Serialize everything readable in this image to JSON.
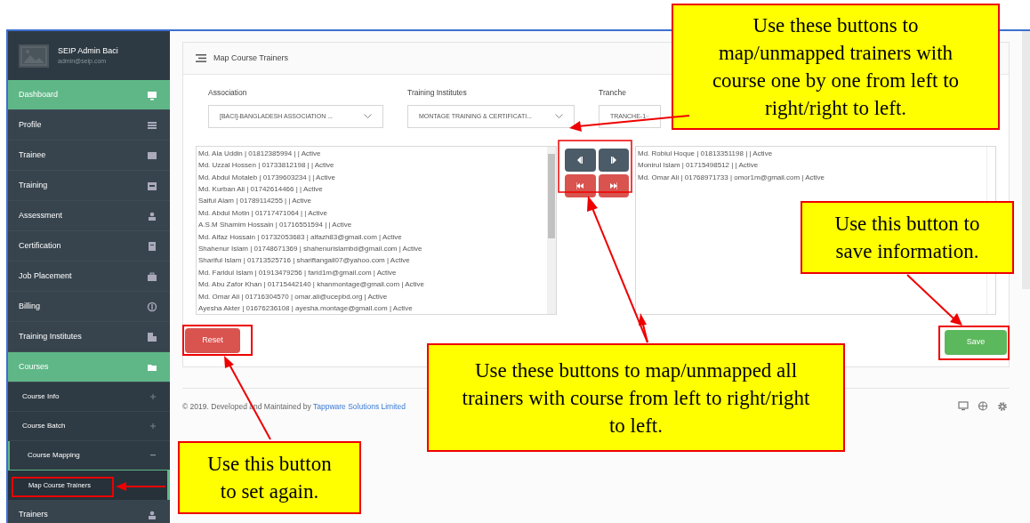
{
  "sidebar": {
    "user": {
      "name": "SEIP Admin Baci",
      "email": "admin@seip.com"
    },
    "items": [
      {
        "label": "Dashboard",
        "selected": true
      },
      {
        "label": "Profile",
        "selected": false
      },
      {
        "label": "Trainee",
        "selected": false
      },
      {
        "label": "Training",
        "selected": false
      },
      {
        "label": "Assessment",
        "selected": false
      },
      {
        "label": "Certification",
        "selected": false
      },
      {
        "label": "Job Placement",
        "selected": false
      },
      {
        "label": "Billing",
        "selected": false
      },
      {
        "label": "Training Institutes",
        "selected": false
      },
      {
        "label": "Courses",
        "selected": true,
        "children": [
          {
            "label": "Course Info",
            "selected": false,
            "expanded": false
          },
          {
            "label": "Course Batch",
            "selected": false,
            "expanded": false
          },
          {
            "label": "Course Mapping",
            "selected": true,
            "expanded": true,
            "children": [
              {
                "label": "Map Course Trainers",
                "selected": true
              }
            ]
          }
        ]
      },
      {
        "label": "Trainers",
        "selected": false
      }
    ]
  },
  "panel": {
    "title": "Map Course Trainers",
    "filters": [
      {
        "label": "Association",
        "value": "[BACI]-BANGLADESH ASSOCIATION ..."
      },
      {
        "label": "Training Institutes",
        "value": "MONTAGE TRAINING & CERTIFICATI..."
      },
      {
        "label": "Tranche",
        "value": "TRANCHE-1"
      }
    ],
    "available_trainers": [
      "Md. Ala Uddin | 01812385994 | | Active",
      "Md. Uzzal Hossen | 01733812198 | | Active",
      "Md. Abdul Motaleb | 01739603234 | | Active",
      "Md. Kurban Ali | 01742614466 | | Active",
      "Saiful Alam | 01789114255 | | Active",
      "Md. Abdul Motin | 01717471064 | | Active",
      "A.S.M Shamim Hossain | 01716551594 | | Active",
      "Md. Alfaz Hossain | 01732053683 | alfazh83@gmail.com | Active",
      "Shahenur Islam | 01748671369 | shahenurislambd@gmail.com | Active",
      "Shariful Islam | 01713525716 | shariftangail07@yahoo.com | Active",
      "Md. Faridul Islam | 01913479256 | farid1m@gmail.com | Active",
      "Md. Abu Zafor Khan | 01715442140 | khanmontage@gmail.com | Active",
      "Md. Omar Ali | 01716304570 | omar.ali@ucepbd.org | Active",
      "Ayesha Akter | 01676236108 | ayesha.montage@gmail.com | Active"
    ],
    "transfer_buttons": [
      {
        "kind": "previous"
      },
      {
        "kind": "next"
      },
      {
        "kind": "first"
      },
      {
        "kind": "last"
      }
    ],
    "mapped_trainers": [
      "Md. Robiul Hoque | 01813351198 | | Active",
      "Monirul Islam | 01715498512 | | Active",
      "Md. Omar Ali | 01768971733 | omor1m@gmail.com | Active"
    ],
    "reset_button": "Reset",
    "save_button": "Save"
  },
  "footer": {
    "text": "© 2019. Developed and Maintained by",
    "link": "Tappware Solutions Limited"
  },
  "annotations": [
    {
      "text": "Use these buttons to map/unmapped trainers with course one by one from left to right/right to left."
    },
    {
      "text": "Use this button to save information."
    },
    {
      "text": "Use these buttons to map/unmapped all trainers with course from left to right/right to left."
    },
    {
      "text": "Use this button to set again."
    }
  ]
}
